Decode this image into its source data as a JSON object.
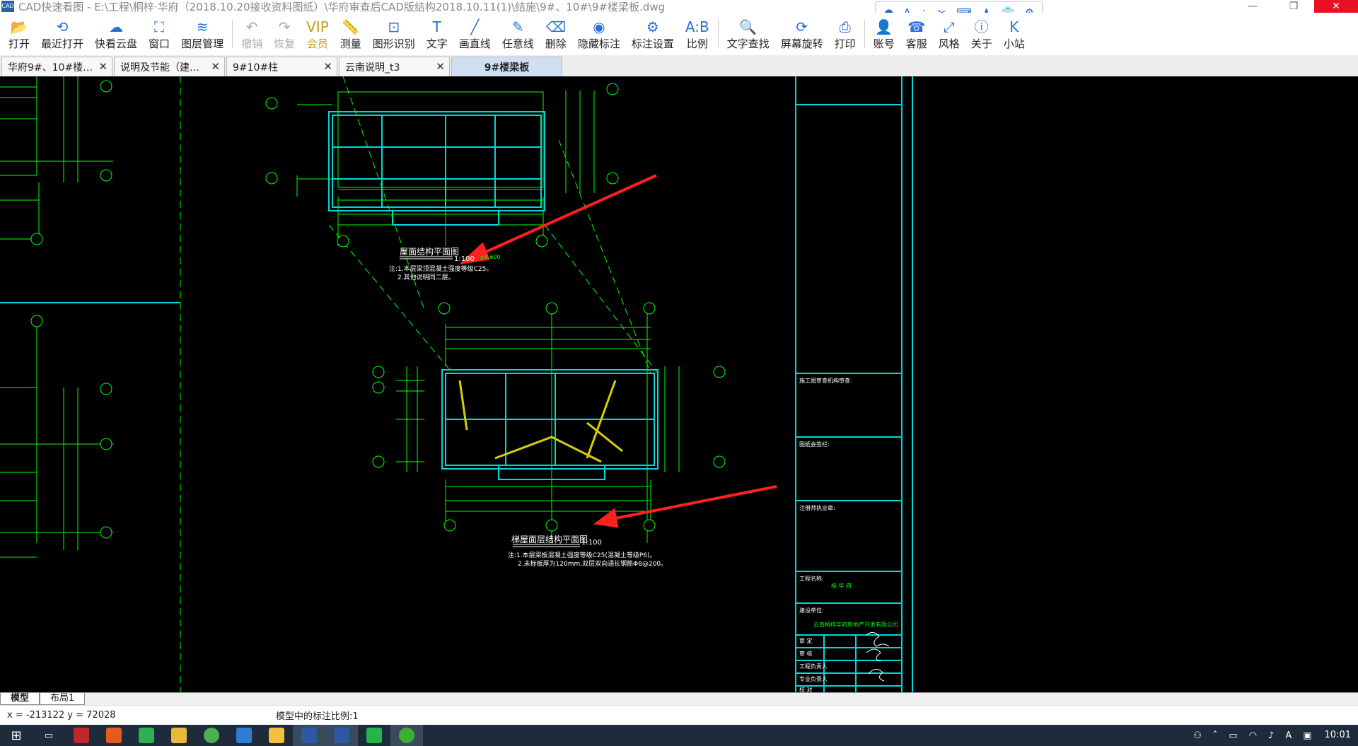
{
  "app": {
    "title": "CAD快速看图 - E:\\工程\\桐梓·华府（2018.10.20接收资料图纸）\\华府审查后CAD版结构2018.10.11(1)\\结施\\9#、10#\\9#楼梁板.dwg",
    "icon_label": "CAD"
  },
  "window_controls": {
    "minimize": "—",
    "restore": "❐",
    "close": "✕"
  },
  "floatbar": {
    "items": [
      "user-icon",
      "text-a-icon",
      "dots-icon",
      "scissors-icon",
      "keyboard-icon",
      "person-icon",
      "shirt-icon",
      "gear-icon"
    ]
  },
  "toolbar": {
    "items": [
      {
        "label": "打开",
        "icon": "📂"
      },
      {
        "label": "最近打开",
        "icon": "⟲"
      },
      {
        "label": "快看云盘",
        "icon": "☁"
      },
      {
        "label": "窗口",
        "icon": "⛶"
      },
      {
        "label": "图层管理",
        "icon": "≋"
      },
      {
        "label": "撤销",
        "icon": "↶"
      },
      {
        "label": "恢复",
        "icon": "↷"
      },
      {
        "label": "会员",
        "icon": "VIP"
      },
      {
        "label": "测量",
        "icon": "📏"
      },
      {
        "label": "图形识别",
        "icon": "⊡"
      },
      {
        "label": "文字",
        "icon": "T"
      },
      {
        "label": "画直线",
        "icon": "╱"
      },
      {
        "label": "任意线",
        "icon": "✎"
      },
      {
        "label": "删除",
        "icon": "⌫"
      },
      {
        "label": "隐藏标注",
        "icon": "◉"
      },
      {
        "label": "标注设置",
        "icon": "⚙"
      },
      {
        "label": "比例",
        "icon": "A:B"
      },
      {
        "label": "文字查找",
        "icon": "🔍"
      },
      {
        "label": "屏幕旋转",
        "icon": "⟳"
      },
      {
        "label": "打印",
        "icon": "⎙"
      },
      {
        "label": "账号",
        "icon": "👤"
      },
      {
        "label": "客服",
        "icon": "☎"
      },
      {
        "label": "风格",
        "icon": "⤢"
      },
      {
        "label": "关于",
        "icon": "ⓘ"
      },
      {
        "label": "小站",
        "icon": "K"
      }
    ]
  },
  "tabs": [
    {
      "label": "华府9#、10#楼…",
      "active": false
    },
    {
      "label": "说明及节能（建…",
      "active": false
    },
    {
      "label": "9#10#柱",
      "active": false
    },
    {
      "label": "云南说明_t3",
      "active": false
    },
    {
      "label": "9#楼梁板",
      "active": true
    }
  ],
  "drawing": {
    "plan1_title": "屋面结构平面图",
    "plan1_scale": "1:100",
    "plan1_note1": "注:1.本层梁顶混凝土强度等级C25。",
    "plan1_note2": "2.其他说明同二层。",
    "plan1_elev": "±4.600",
    "plan2_title": "梯屋面层结构平面图",
    "plan2_scale": "1:100",
    "plan2_note1": "注:1.本层梁板混凝土强度等级C25(混凝土等级P6)。",
    "plan2_note2": "2.未标板厚为120mm,双层双向通长钢筋Φ8@200。",
    "titleblock_rows": [
      "施工图审查机构审查:",
      "图纸会签栏:",
      "注册师执业章:",
      "工程名称:",
      "建设单位:"
    ],
    "titleblock_project": "桂 华 府",
    "titleblock_client": "云南桐梓华府房地产开发有限公司",
    "titleblock_sign_rows": [
      "审 定",
      "审 核",
      "工程负责人",
      "专业负责人",
      "校 对"
    ]
  },
  "layout_tabs": [
    {
      "label": "模型",
      "active": true
    },
    {
      "label": "布局1",
      "active": false
    }
  ],
  "status": {
    "coords": "x = -213122  y = 72028",
    "scale_text": "模型中的标注比例:1"
  },
  "taskbar": {
    "time": "10:01"
  }
}
